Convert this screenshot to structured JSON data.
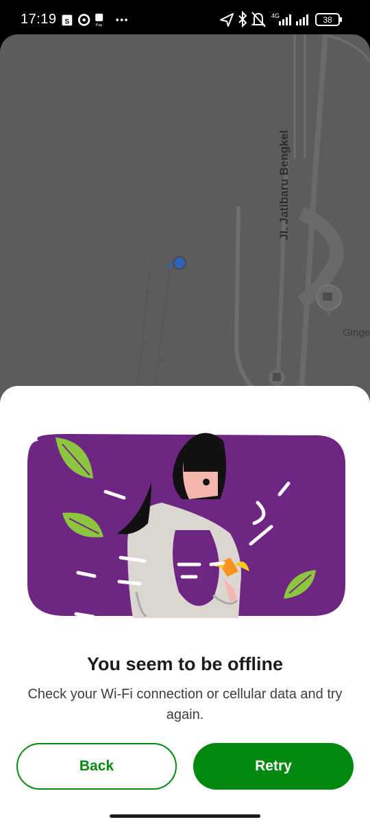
{
  "status_bar": {
    "time": "17:19",
    "network_type": "4G",
    "battery": "38",
    "icons": [
      "shopee-icon",
      "location-app-icon",
      "shopeepay-icon",
      "more-dots-icon",
      "navigation-icon",
      "bluetooth-icon",
      "bell-off-icon",
      "signal-icon",
      "battery-icon"
    ]
  },
  "map": {
    "road_label": "Jl. Jatibaru Bengkel",
    "poi_label": "Ginge",
    "colors": {
      "background": "#5c5c5c",
      "road": "#6e6e6e",
      "location_dot": "#2f63b8"
    }
  },
  "dialog": {
    "title": "You seem to be offline",
    "message": "Check your Wi-Fi connection or cellular data and try again.",
    "back_label": "Back",
    "retry_label": "Retry",
    "colors": {
      "primary": "#00880f",
      "illustration_bg": "#6e2683",
      "leaf": "#8cc63f"
    }
  }
}
